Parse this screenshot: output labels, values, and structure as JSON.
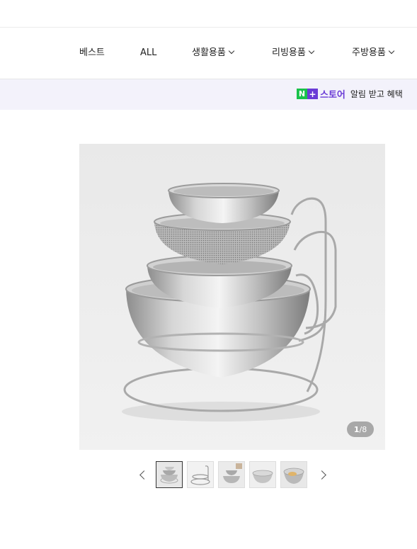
{
  "nav": {
    "items": [
      {
        "label": "베스트",
        "dropdown": false
      },
      {
        "label": "ALL",
        "dropdown": false
      },
      {
        "label": "생활용품",
        "dropdown": true
      },
      {
        "label": "리빙용품",
        "dropdown": true
      },
      {
        "label": "주방용품",
        "dropdown": true
      }
    ]
  },
  "banner": {
    "n_badge": "N",
    "plus_badge": "+",
    "store_label": "스토어",
    "message": "알림 받고 혜택"
  },
  "gallery": {
    "current": "1",
    "separator": "/",
    "total": "8",
    "thumbnails": [
      "thumb-1",
      "thumb-2",
      "thumb-3",
      "thumb-4",
      "thumb-5"
    ],
    "active_index": 0
  },
  "colors": {
    "naver_green": "#19c24a",
    "store_purple": "#6a3bd6",
    "banner_bg": "#f3f2fb"
  }
}
